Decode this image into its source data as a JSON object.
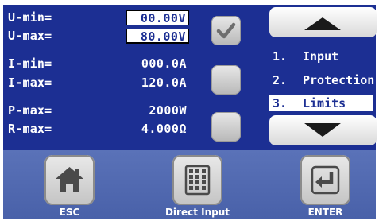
{
  "params": [
    {
      "label": "U-min=",
      "value": "00.00V",
      "editable": true
    },
    {
      "label": "U-max=",
      "value": "80.00V",
      "editable": true
    },
    {
      "label": "I-min=",
      "value": "000.0A",
      "editable": false
    },
    {
      "label": "I-max=",
      "value": "120.0A",
      "editable": false
    },
    {
      "label": "P-max=",
      "value": "2000W",
      "editable": false
    },
    {
      "label": "R-max=",
      "value": "4.000Ω",
      "editable": false
    }
  ],
  "checkboxes": [
    {
      "icon": "checkmark-icon",
      "checked": true
    },
    {
      "icon": "",
      "checked": false
    },
    {
      "icon": "",
      "checked": false
    }
  ],
  "menu": [
    {
      "num": "1.",
      "label": "Input",
      "selected": false
    },
    {
      "num": "2.",
      "label": "Protection",
      "selected": false
    },
    {
      "num": "3.",
      "label": "Limits",
      "selected": true
    }
  ],
  "nav": {
    "up_icon": "triangle-up-icon",
    "down_icon": "triangle-down-icon"
  },
  "bottom_bar": {
    "esc_label": "ESC",
    "direct_input_label": "Direct Input",
    "enter_label": "ENTER",
    "esc_icon": "home-icon",
    "direct_input_icon": "keypad-icon",
    "enter_icon": "enter-arrow-icon"
  },
  "colors": {
    "panel": "#1c2f93",
    "bottom_bar": "#4961a9",
    "value_text": "#1c2f93"
  }
}
